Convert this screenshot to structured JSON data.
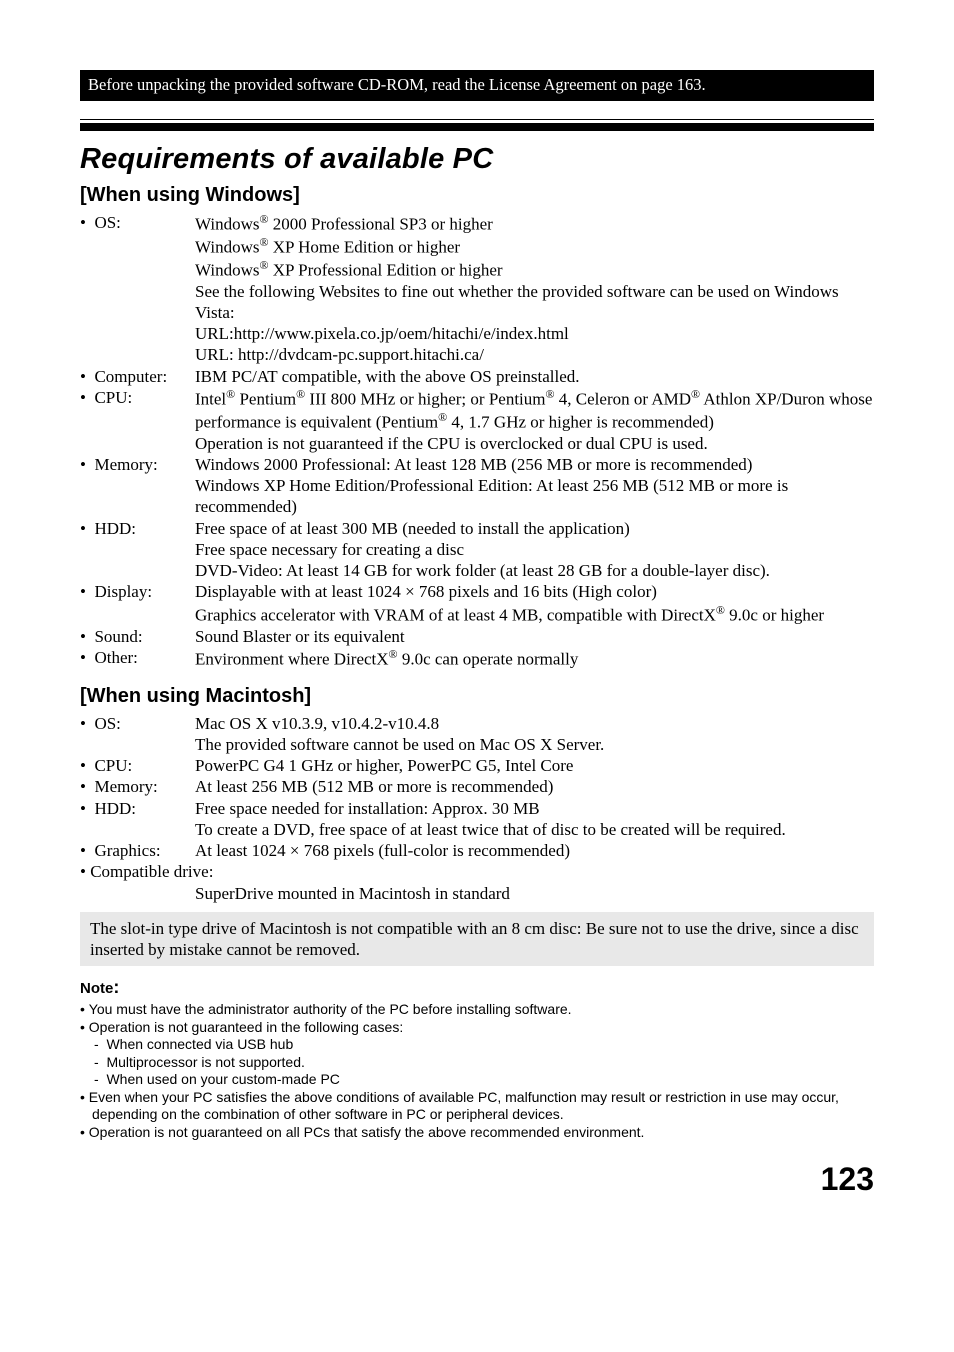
{
  "black_bar": "Before unpacking the provided software CD-ROM, read the License Agreement on page 163.",
  "title": "Requirements of available PC",
  "windows": {
    "heading": "[When using Windows]",
    "items": [
      {
        "label": "OS:",
        "value": "Windows<sup>®</sup> 2000 Professional SP3 or higher<br>Windows<sup>®</sup> XP Home Edition or higher<br>Windows<sup>®</sup> XP Professional Edition or higher<br>See the following Websites to fine out whether the provided software can be used on Windows Vista:<br>URL:http://www.pixela.co.jp/oem/hitachi/e/index.html<br>URL: http://dvdcam-pc.support.hitachi.ca/"
      },
      {
        "label": "Computer:",
        "value": "IBM PC/AT compatible, with the above OS preinstalled."
      },
      {
        "label": "CPU:",
        "value": "Intel<sup>®</sup> Pentium<sup>®</sup> III 800 MHz or higher; or Pentium<sup>®</sup> 4, Celeron or AMD<sup>®</sup> Athlon XP/Duron whose performance is equivalent (Pentium<sup>®</sup> 4, 1.7 GHz or higher is recommended)<br>Operation is not guaranteed if the CPU is overclocked or dual CPU is used."
      },
      {
        "label": "Memory:",
        "value": "Windows 2000 Professional: At least 128 MB (256 MB or more is recommended)<br>Windows XP Home Edition/Professional Edition: At least 256 MB (512 MB or more is recommended)"
      },
      {
        "label": "HDD:",
        "value": "Free space of at least 300 MB (needed to install the application)<br>Free space necessary for creating a disc<br>DVD-Video: At least 14 GB for work folder (at least 28 GB for a double-layer disc)."
      },
      {
        "label": "Display:",
        "value": "Displayable with at least 1024 × 768 pixels and 16 bits (High color)<br>Graphics accelerator with VRAM of at least 4 MB, compatible with DirectX<sup>®</sup> 9.0c or higher"
      },
      {
        "label": "Sound:",
        "value": "Sound Blaster or its equivalent"
      },
      {
        "label": "Other:",
        "value": "Environment where DirectX<sup>®</sup> 9.0c can operate normally"
      }
    ]
  },
  "mac": {
    "heading": "[When using Macintosh]",
    "items": [
      {
        "label": "OS:",
        "value": "Mac OS X v10.3.9, v10.4.2-v10.4.8<br>The provided software cannot be used on Mac OS X Server."
      },
      {
        "label": "CPU:",
        "value": "PowerPC G4 1 GHz or higher, PowerPC G5, Intel Core"
      },
      {
        "label": "Memory:",
        "value": "At least 256 MB (512 MB or more is recommended)"
      },
      {
        "label": "HDD:",
        "value": "Free space needed for installation: Approx. 30 MB<br>To create a DVD, free space of at least twice that of disc to be created will be required."
      },
      {
        "label": "Graphics:",
        "value": "At least 1024 × 768 pixels (full-color is recommended)"
      },
      {
        "label": "Compatible drive:",
        "value": "<br>SuperDrive mounted in Macintosh in standard",
        "fullline": true
      }
    ]
  },
  "gray_box": "The slot-in type drive of Macintosh is not compatible with an 8 cm disc: Be sure not to use the drive, since a disc inserted by mistake cannot be removed.",
  "note_heading": "Note",
  "notes": [
    "You must have the administrator authority of the PC before installing software.",
    "Operation is not guaranteed in the following cases:",
    "Even when your PC satisfies the above conditions of available PC, malfunction may result or restriction in use may occur, depending on the combination of other software in PC or peripheral devices.",
    "Operation is not guaranteed on all PCs that satisfy the above recommended environment."
  ],
  "sub_notes": [
    "When connected via USB hub",
    "Multiprocessor is not supported.",
    "When used on your custom-made PC"
  ],
  "page_number": "123"
}
